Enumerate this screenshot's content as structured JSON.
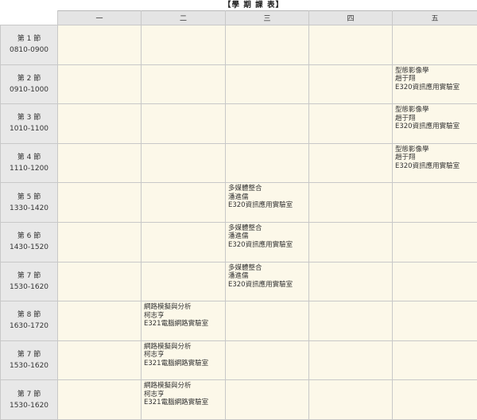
{
  "header": {
    "title": "【學 期 課 表】"
  },
  "days": [
    "一",
    "二",
    "三",
    "四",
    "五"
  ],
  "periods": [
    {
      "label": "第 1 節",
      "time": "0810-0900"
    },
    {
      "label": "第 2 節",
      "time": "0910-1000"
    },
    {
      "label": "第 3 節",
      "time": "1010-1100"
    },
    {
      "label": "第 4 節",
      "time": "1110-1200"
    },
    {
      "label": "第 5 節",
      "time": "1330-1420"
    },
    {
      "label": "第 6 節",
      "time": "1430-1520"
    },
    {
      "label": "第 7 節",
      "time": "1530-1620"
    },
    {
      "label": "第 8 節",
      "time": "1630-1720"
    },
    {
      "label": "第 7 節",
      "time": "1530-1620"
    },
    {
      "label": "第 7 節",
      "time": "1530-1620"
    }
  ],
  "courses": {
    "pattern": {
      "name": "型態影像學",
      "teacher": "趙于翔",
      "room": "E320資訊應用實驗室"
    },
    "multimedia": {
      "name": "多媒體整合",
      "teacher": "潘進儒",
      "room": "E320資訊應用實驗室"
    },
    "network": {
      "name": "網路模擬與分析",
      "teacher": "柯志亨",
      "room": "E321電腦網路實驗室"
    }
  }
}
